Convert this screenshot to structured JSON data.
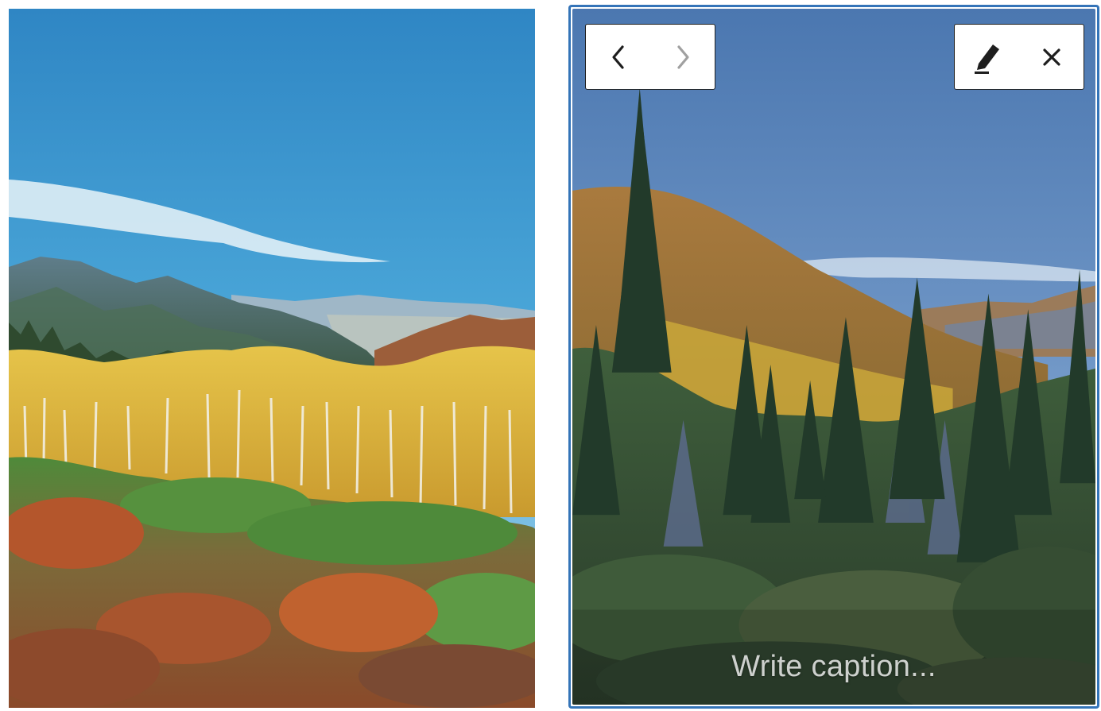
{
  "gallery": {
    "items": [
      {
        "image_alt": "",
        "selected": false
      },
      {
        "image_alt": "",
        "selected": true,
        "caption_placeholder": "Write caption..."
      }
    ]
  },
  "toolbar": {
    "icons": [
      "chevron-left-icon",
      "chevron-right-icon",
      "pencil-icon",
      "close-icon"
    ]
  },
  "colors": {
    "selection_border": "#3474b8",
    "toolbar_border": "#1e1e1e",
    "icon_active": "#1e1e1e",
    "icon_disabled": "#a0a0a0"
  }
}
